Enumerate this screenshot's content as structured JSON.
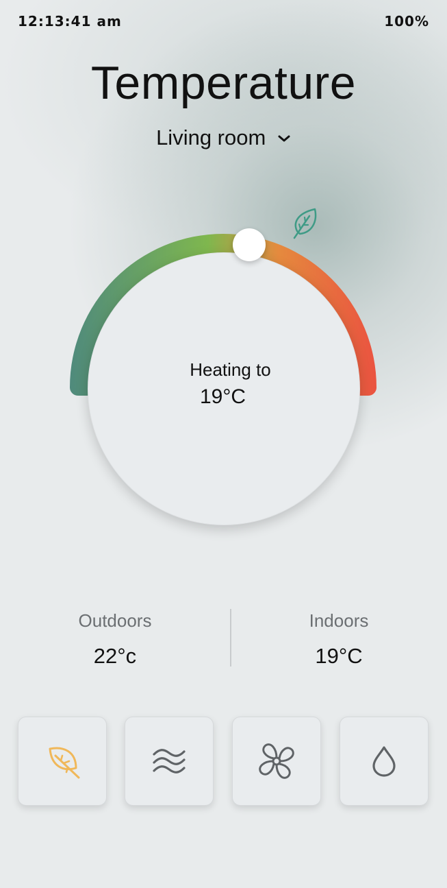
{
  "status_bar": {
    "time": "12:13:41 am",
    "battery": "100%"
  },
  "header": {
    "title": "Temperature",
    "room": "Living room"
  },
  "dial": {
    "label": "Heating to",
    "target": "19°C",
    "gradient_colors": [
      "#4f8a7c",
      "#7fb74e",
      "#e58a3e",
      "#ea5340"
    ]
  },
  "eco_icon": "leaf-icon",
  "readings": {
    "outdoors": {
      "label": "Outdoors",
      "value": "22°c"
    },
    "indoors": {
      "label": "Indoors",
      "value": "19°C"
    }
  },
  "modes": [
    {
      "icon": "leaf-icon",
      "active": true,
      "color": "#f0b85a"
    },
    {
      "icon": "waves-icon",
      "active": false,
      "color": "#5f6366"
    },
    {
      "icon": "fan-icon",
      "active": false,
      "color": "#5f6366"
    },
    {
      "icon": "droplet-icon",
      "active": false,
      "color": "#5f6366"
    }
  ]
}
